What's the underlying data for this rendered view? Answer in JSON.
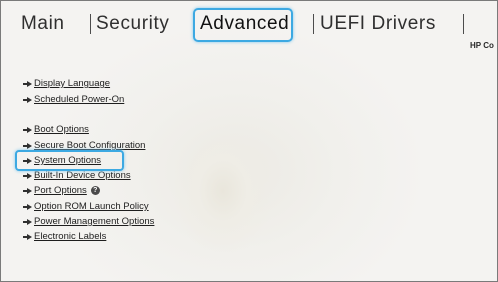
{
  "tabs": {
    "main": "Main",
    "security": "Security",
    "advanced": "Advanced",
    "uefi_drivers": "UEFI Drivers"
  },
  "brand": "HP Co",
  "options": {
    "display_language": "Display Language",
    "scheduled_power_on": "Scheduled Power-On",
    "boot_options": "Boot Options",
    "secure_boot_configuration": "Secure Boot Configuration",
    "system_options": "System Options",
    "built_in_device_options": "Built-In Device Options",
    "port_options": "Port Options",
    "option_rom_launch_policy": "Option ROM Launch Policy",
    "power_management_options": "Power Management Options",
    "electronic_labels": "Electronic Labels"
  },
  "help_glyph": "?",
  "colors": {
    "highlight": "#3da9e2",
    "text": "#1e1e1e"
  }
}
